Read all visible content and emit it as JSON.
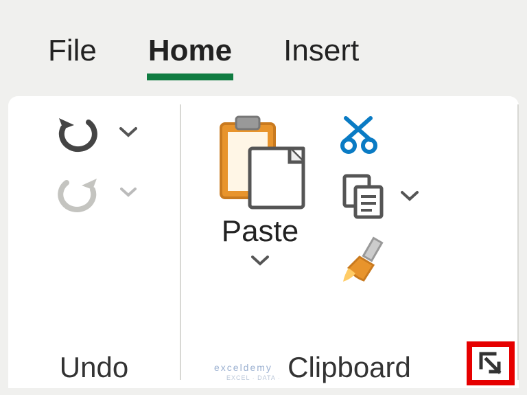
{
  "tabs": {
    "file": "File",
    "home": "Home",
    "insert": "Insert",
    "active": "home"
  },
  "groups": {
    "undo": {
      "label": "Undo"
    },
    "clipboard": {
      "label": "Clipboard",
      "paste_label": "Paste"
    }
  },
  "watermark": {
    "main": "exceldemy",
    "sub": "EXCEL · DATA ·"
  }
}
